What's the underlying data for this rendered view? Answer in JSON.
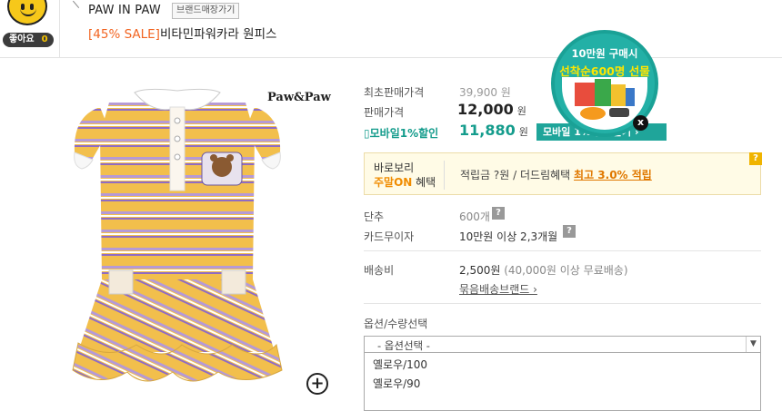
{
  "header": {
    "like_label": "좋아요",
    "like_count": "0",
    "brand_name": "PAW IN PAW",
    "brand_store_button": "브랜드매장가기",
    "title_sale": "[45% SALE]",
    "title_name": "비타민파워카라 원피스"
  },
  "product": {
    "image_logo": "Paw&Paw",
    "zoom_icon": "zoom-plus-icon"
  },
  "pricing": {
    "orig_label": "최초판매가격",
    "orig_value": "39,900 원",
    "sale_label": "판매가격",
    "sale_value": "12,000",
    "sale_unit": "원",
    "mobile_label": "모바일1%할인",
    "mobile_value": "11,880",
    "mobile_unit": "원",
    "mobile_button": "모바일 1% 할인받기 ›"
  },
  "benefit": {
    "left_line1": "바로보리",
    "left_on": "주말ON",
    "left_suffix": " 혜택",
    "text_prefix": "적립금 ?원 / 더드림혜택 ",
    "text_highlight": "최고 3.0% 적립",
    "help": "?"
  },
  "details": {
    "unit_label": "단추",
    "unit_value": "600개",
    "card_label": "카드무이자",
    "card_value": "10만원 이상 2,3개월",
    "shipping_label": "배송비",
    "shipping_value": "2,500원",
    "shipping_note": "(40,000원 이상 무료배송)",
    "bundle_link": "묶음배송브랜드 ›",
    "help": "?"
  },
  "options": {
    "section_label": "옵션/수량선택",
    "select_placeholder": "- 옵션선택 -",
    "items": [
      "옐로우/100",
      "옐로우/90"
    ]
  },
  "promo": {
    "line1": "10만원 구매시",
    "line2": "선착순600명 선물",
    "close": "x"
  },
  "colors": {
    "accent_sale": "#f26522",
    "mobile_teal": "#149c8c",
    "promo_teal": "#23b0a6",
    "benefit_orange": "#e07800"
  }
}
